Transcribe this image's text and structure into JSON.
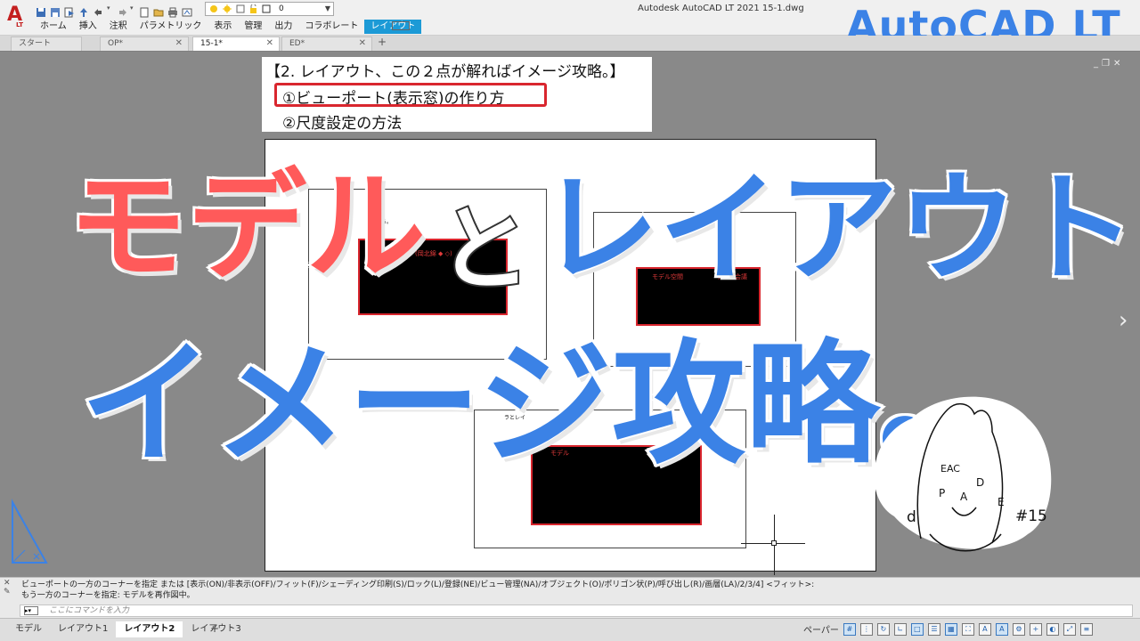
{
  "window": {
    "title": "Autodesk AutoCAD LT 2021    15-1.dwg",
    "layer_value": "0"
  },
  "ribbon": {
    "tabs": [
      "ホーム",
      "挿入",
      "注釈",
      "パラメトリック",
      "表示",
      "管理",
      "出力",
      "コラボレート",
      "レイアウト"
    ],
    "active_tab": "レイアウト"
  },
  "brand": "AutoCAD LT",
  "file_tabs": {
    "items": [
      "スタート",
      "OP*",
      "15-1*",
      "ED*"
    ],
    "active": "15-1*",
    "add_label": "+"
  },
  "note": {
    "heading": "【2. レイアウト、この２点が解ればイメージ攻略。】",
    "item1": "①ビューポート(表示窓)の作り方",
    "item2": "②尺度設定の方法"
  },
  "viewports": {
    "label1": "(岡北錦 ◆ ◇)",
    "label2a": "モデル空間",
    "label2b": "ライブ会議",
    "label3": "モデル",
    "tiny1": "なる。",
    "tiny2": "ラとレイ"
  },
  "overlay": {
    "model": "モデル",
    "to": "と",
    "layout": "レイアウト",
    "kouryaku": "イメージ攻略。"
  },
  "mascot": {
    "letters": [
      "EAC",
      "P",
      "A",
      "D",
      "E",
      "d"
    ],
    "episode": "#15"
  },
  "canvas_controls": [
    "_",
    "❐",
    "✕"
  ],
  "command": {
    "history1": "ビューポートの一方のコーナーを指定 または [表示(ON)/非表示(OFF)/フィット(F)/シェーディング印刷(S)/ロック(L)/登録(NE)/ビュー管理(NA)/オブジェクト(O)/ポリゴン状(P)/呼び出し(R)/画層(LA)/2/3/4] <フィット>:",
    "history2": "もう一方のコーナーを指定: モデルを再作図中。",
    "placeholder": "ここにコマンドを入力"
  },
  "layout_tabs": {
    "items": [
      "モデル",
      "レイアウト1",
      "レイアウト2",
      "レイアウト3"
    ],
    "active": "レイアウト2",
    "add_label": "+"
  },
  "status": {
    "space_label": "ペーパー"
  },
  "colors": {
    "accent_blue": "#3b82e6",
    "accent_red": "#ff5a5a",
    "ribbon_active": "#1c9ad6",
    "viewport_frame": "#d9262e"
  }
}
